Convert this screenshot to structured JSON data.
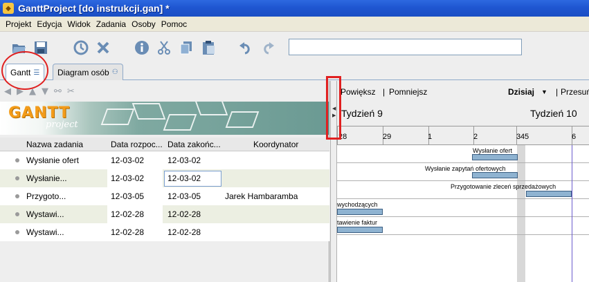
{
  "window": {
    "title": "GanttProject [do instrukcji.gan] *"
  },
  "menu": [
    "Projekt",
    "Edycja",
    "Widok",
    "Zadania",
    "Osoby",
    "Pomoc"
  ],
  "toolbar": {
    "search_value": "",
    "icons": [
      "open-icon",
      "save-icon",
      "clock-icon",
      "delete-icon",
      "info-icon",
      "cut-icon",
      "copy-icon",
      "paste-icon",
      "undo-icon",
      "redo-icon"
    ]
  },
  "tabs": [
    {
      "label": "Gantt",
      "active": true
    },
    {
      "label": "Diagram osób",
      "active": false
    }
  ],
  "logo": {
    "main": "GANTT",
    "sub": "project"
  },
  "table": {
    "headers": [
      "Nazwa zadania",
      "Data rozpoc...",
      "Data zakońc...",
      "Koordynator"
    ],
    "rows": [
      {
        "name": "Wysłanie ofert",
        "start": "12-03-02",
        "end": "12-03-02",
        "coordinator": ""
      },
      {
        "name": "Wysłanie...",
        "start": "12-03-02",
        "end": "12-03-02",
        "coordinator": ""
      },
      {
        "name": "Przygoto...",
        "start": "12-03-05",
        "end": "12-03-05",
        "coordinator": "Jarek Hambaramba"
      },
      {
        "name": "Wystawi...",
        "start": "12-02-28",
        "end": "12-02-28",
        "coordinator": ""
      },
      {
        "name": "Wystawi...",
        "start": "12-02-28",
        "end": "12-02-28",
        "coordinator": ""
      }
    ]
  },
  "chart_toolbar": {
    "zoom_in": "Powiększ",
    "zoom_out": "Pomniejsz",
    "today": "Dzisiaj",
    "move": "Przesuń",
    "separator": "|"
  },
  "timeline": {
    "weeks": [
      "Tydzień 9",
      "Tydzień 10"
    ],
    "days": [
      "28",
      "29",
      "1",
      "2",
      "3",
      "4",
      "5",
      "6"
    ]
  },
  "gantt_labels": [
    "Wysłanie ofert",
    "Wysłanie zapytań ofertowych",
    "Przygotowanie zleceń sprzedażowych",
    "wychodzących",
    "tawienie faktur"
  ]
}
